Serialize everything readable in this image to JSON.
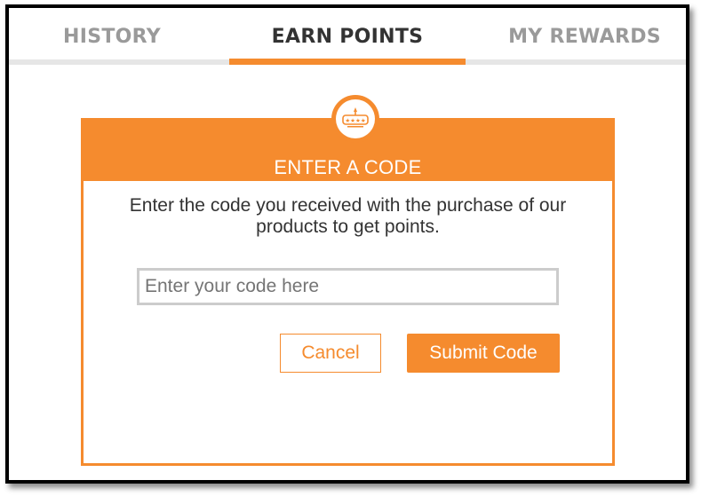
{
  "tabs": [
    {
      "label": "HISTORY",
      "active": false
    },
    {
      "label": "EARN POINTS",
      "active": true
    },
    {
      "label": "MY REWARDS",
      "active": false
    }
  ],
  "card": {
    "title": "ENTER A CODE",
    "badge_icon": "rating-stars-icon",
    "badge_text": "★★★★",
    "instructions_line1": "Enter the code you received with the purchase of our",
    "instructions_line2": "products to get points.",
    "code_input": {
      "value": "",
      "placeholder": "Enter your code here"
    },
    "cancel_label": "Cancel",
    "submit_label": "Submit Code"
  },
  "colors": {
    "accent": "#f58b2e",
    "active_tab_text": "#333333",
    "inactive_tab_text": "#9a9a9a",
    "tab_baseline": "#e6e6e6"
  }
}
